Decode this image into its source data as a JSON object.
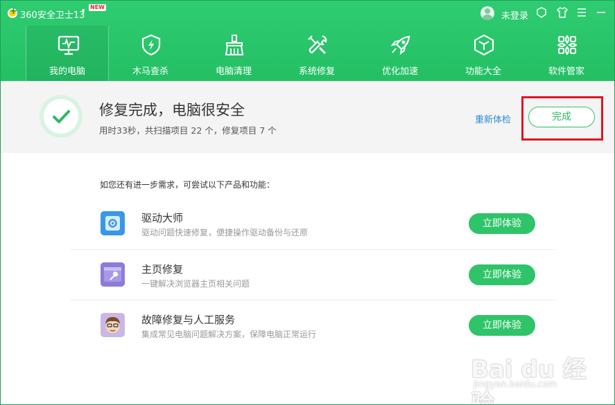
{
  "titlebar": {
    "app_title": "360安全卫士13",
    "new_badge": "NEW",
    "login_text": "未登录"
  },
  "nav": {
    "items": [
      {
        "label": "我的电脑",
        "icon": "monitor-icon",
        "active": true
      },
      {
        "label": "木马查杀",
        "icon": "shield-icon",
        "active": false
      },
      {
        "label": "电脑清理",
        "icon": "broom-icon",
        "active": false
      },
      {
        "label": "系统修复",
        "icon": "wrench-icon",
        "active": false
      },
      {
        "label": "优化加速",
        "icon": "rocket-icon",
        "active": false
      },
      {
        "label": "功能大全",
        "icon": "cube-icon",
        "active": false
      },
      {
        "label": "软件管家",
        "icon": "apps-icon",
        "active": false
      }
    ]
  },
  "result": {
    "title": "修复完成，电脑很安全",
    "desc": "用时33秒，共扫描项目 22 个，修复项目 7 个",
    "recheck_label": "重新体检",
    "done_label": "完成"
  },
  "suggest": {
    "prompt": "如您还有进一步需求，可尝试以下产品和功能：",
    "items": [
      {
        "title": "驱动大师",
        "desc": "驱动问题快速修复，便捷操作驱动备份与还原",
        "button": "立即体验",
        "icon": "driver-master-icon"
      },
      {
        "title": "主页修复",
        "desc": "一键解决浏览器主页相关问题",
        "button": "立即体验",
        "icon": "homepage-repair-icon"
      },
      {
        "title": "故障修复与人工服务",
        "desc": "集成常见电脑问题解决方案，保障电脑正常运行",
        "button": "立即体验",
        "icon": "support-person-icon"
      }
    ]
  },
  "watermark": {
    "main": "Bai du 经验",
    "sub": "jingyan.baidu.com"
  },
  "colors": {
    "brand_green": "#2fcc72",
    "button_green": "#2fc469",
    "highlight_red": "#e0141e",
    "link_blue": "#2a8ad5"
  }
}
